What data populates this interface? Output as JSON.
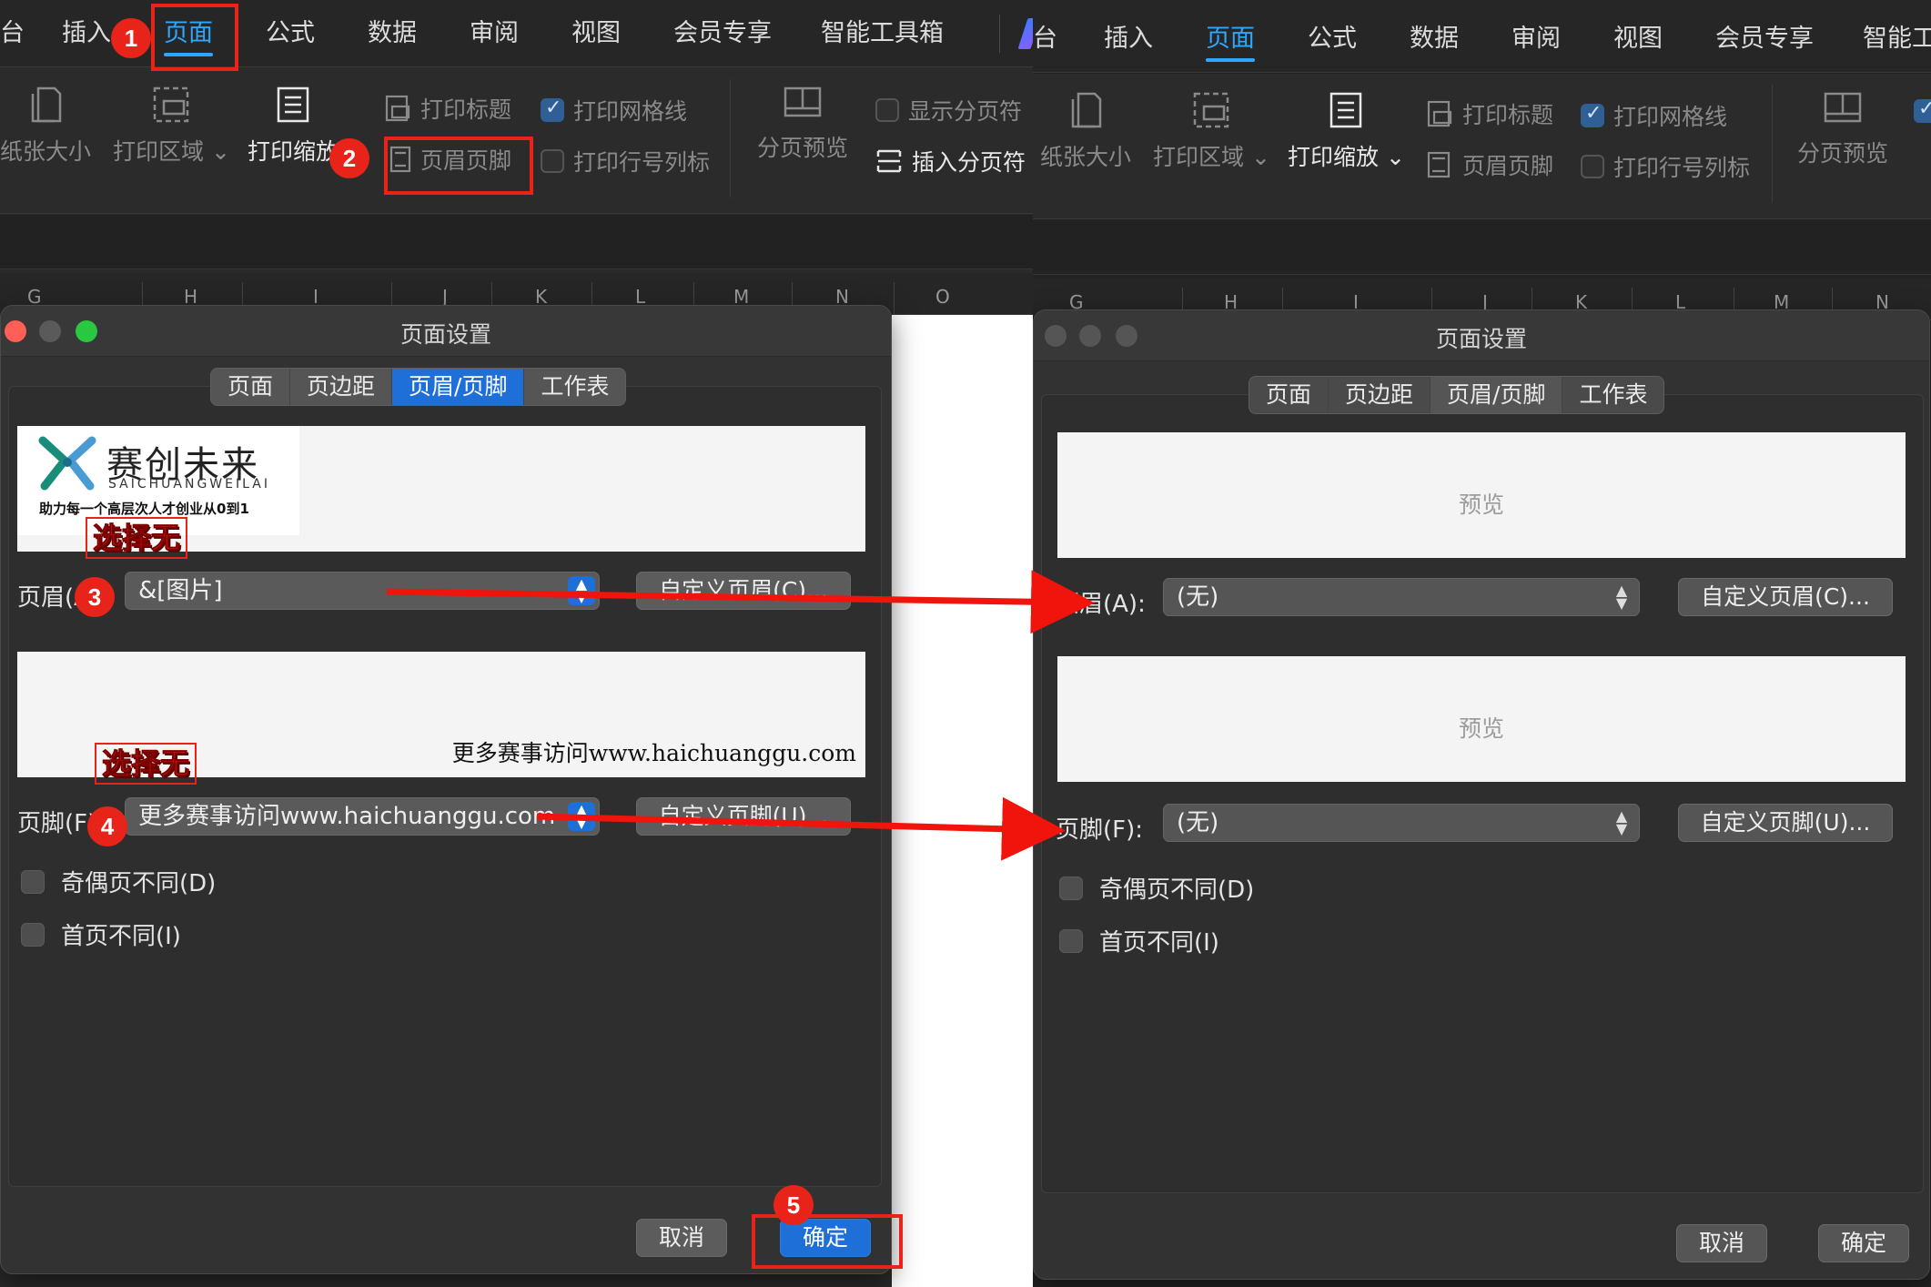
{
  "menu": {
    "cut_left": "台",
    "items": [
      "插入",
      "页面",
      "公式",
      "数据",
      "审阅",
      "视图",
      "会员专享",
      "智能工具箱"
    ],
    "right_cut_left": "台",
    "right_last": "智能工"
  },
  "toolbar": {
    "paper_size": "纸张大小",
    "print_area": "打印区域",
    "print_scale": "打印缩放",
    "print_title": "打印标题",
    "header_footer": "页眉页脚",
    "print_gridlines": "打印网格线",
    "print_row_col": "打印行号列标",
    "page_break_preview": "分页预览",
    "show_page_breaks": "显示分页符",
    "insert_page_break": "插入分页符"
  },
  "columns": [
    "G",
    "H",
    "I",
    "J",
    "K",
    "L",
    "M",
    "N",
    "O"
  ],
  "dialog": {
    "title": "页面设置",
    "tabs": [
      "页面",
      "页边距",
      "页眉/页脚",
      "工作表"
    ],
    "header_label": "页眉(A):",
    "footer_label": "页脚(F):",
    "header_value_before": "&[图片]",
    "footer_value_before": "更多赛事访问www.haichuanggu.com",
    "header_value_after": "(无)",
    "footer_value_after": "(无)",
    "custom_header": "自定义页眉(C)...",
    "custom_footer": "自定义页脚(U)...",
    "preview_text": "预览",
    "odd_even": "奇偶页不同(D)",
    "first_page": "首页不同(I)",
    "cancel": "取消",
    "ok": "确定"
  },
  "logo": {
    "name": "赛创未来",
    "pinyin": "SAICHUANGWEILAI",
    "slogan": "助力每一个高层次人才创业从0到1"
  },
  "footer_preview_text": "更多赛事访问www.haichuanggu.com",
  "annotations": {
    "badges": [
      "1",
      "2",
      "3",
      "4",
      "5"
    ],
    "callout_header": "选择无",
    "callout_footer": "选择无"
  },
  "colors": {
    "accent": "#2ea7ff",
    "annotation_red": "#e8231a",
    "primary_button": "#1f6fd8"
  }
}
